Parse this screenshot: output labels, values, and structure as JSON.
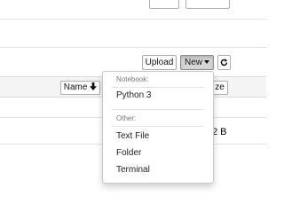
{
  "toolbar": {
    "upload_label": "Upload",
    "new_label": "New"
  },
  "list_header": {
    "name_label": "Name",
    "size_label": "ze"
  },
  "file_row": {
    "size": "2 B"
  },
  "new_menu": {
    "notebook_header": "Notebook:",
    "python3_label": "Python 3",
    "other_header": "Other:",
    "text_file_label": "Text File",
    "folder_label": "Folder",
    "terminal_label": "Terminal"
  },
  "icons": {
    "refresh": "refresh-icon",
    "sort_arrow": "arrow-down-icon",
    "caret": "caret-down-icon"
  }
}
